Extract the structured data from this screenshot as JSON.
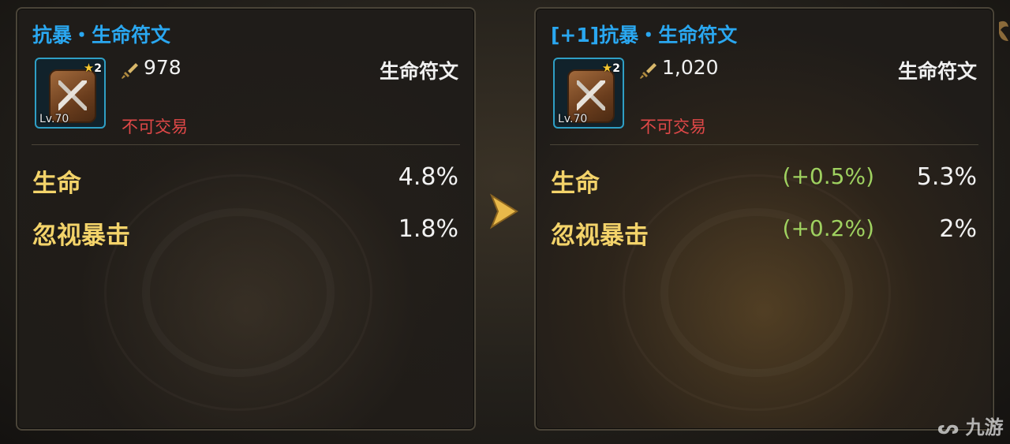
{
  "left": {
    "title": "抗暴・生命符文",
    "star_count": "2",
    "level": "Lv.70",
    "power": "978",
    "type": "生命符文",
    "trade_status": "不可交易",
    "stats": [
      {
        "name": "生命",
        "value": "4.8%"
      },
      {
        "name": "忽视暴击",
        "value": "1.8%"
      }
    ]
  },
  "right": {
    "title": "[+1]抗暴・生命符文",
    "star_count": "2",
    "level": "Lv.70",
    "power": "1,020",
    "type": "生命符文",
    "trade_status": "不可交易",
    "stats": [
      {
        "name": "生命",
        "diff": "(+0.5%)",
        "value": "5.3%"
      },
      {
        "name": "忽视暴击",
        "diff": "(+0.2%)",
        "value": "2%"
      }
    ]
  },
  "watermark": "九游",
  "colors": {
    "title": "#2aa7f0",
    "stat_name": "#f3d36a",
    "diff": "#9fd160",
    "not_tradeable": "#e04848",
    "arrow": "#e8b94a"
  },
  "icons": {
    "power": "sword-power-icon",
    "star": "star-icon",
    "compare_arrow": "chevron-right-icon",
    "rune": "rune-item-icon"
  }
}
